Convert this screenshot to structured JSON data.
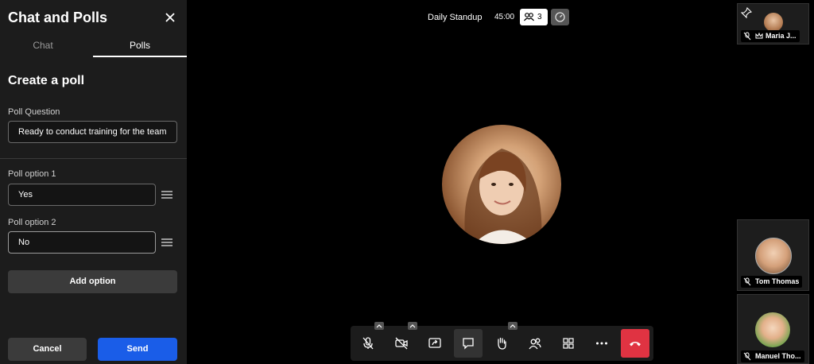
{
  "panel": {
    "title": "Chat and Polls",
    "tabs": [
      {
        "label": "Chat"
      },
      {
        "label": "Polls"
      }
    ],
    "active_tab": "Polls",
    "create_title": "Create a poll",
    "question_label": "Poll Question",
    "question_value": "Ready to conduct training for the team",
    "options": [
      {
        "label": "Poll option 1",
        "value": "Yes"
      },
      {
        "label": "Poll option 2",
        "value": "No"
      }
    ],
    "add_option_label": "Add option",
    "cancel_label": "Cancel",
    "send_label": "Send"
  },
  "meeting": {
    "title": "Daily Standup",
    "timer": "45:00",
    "participant_count": "3"
  },
  "tiles": [
    {
      "name": "Maria J...",
      "role_icon": "crown-icon",
      "pinned": true
    },
    {
      "name": "Tom Thomas"
    },
    {
      "name": "Manuel Tho..."
    }
  ],
  "toolbar": {
    "buttons": [
      "microphone-off-icon",
      "camera-off-icon",
      "share-screen-icon",
      "chat-icon",
      "raise-hand-icon",
      "participants-icon",
      "grid-view-icon",
      "more-icon",
      "end-call-icon"
    ],
    "active": "chat-icon"
  },
  "colors": {
    "panel_bg": "#1c1c1c",
    "send_blue": "#1a5de8",
    "end_call_red": "#e03342",
    "stage_bg": "#000000"
  }
}
